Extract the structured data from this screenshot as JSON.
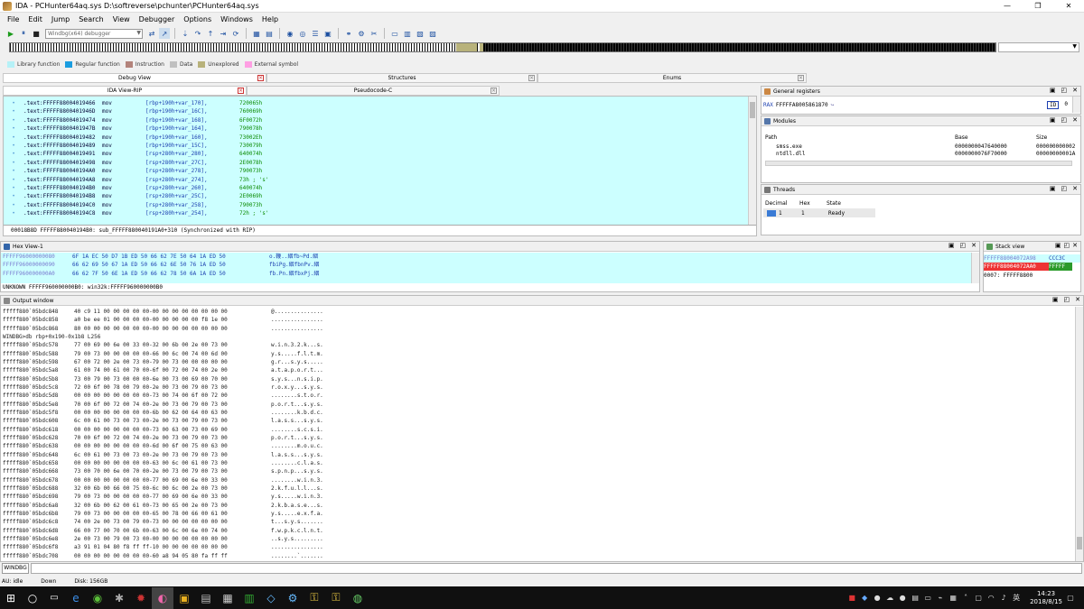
{
  "window": {
    "title": "IDA - PCHunter64aq.sys D:\\softreverse\\pchunter\\PCHunter64aq.sys",
    "controls": [
      "—",
      "❐",
      "✕"
    ]
  },
  "menu": [
    "File",
    "Edit",
    "Jump",
    "Search",
    "View",
    "Debugger",
    "Options",
    "Windows",
    "Help"
  ],
  "toolbar": {
    "debugger_select": "Windbg(x64) debugger"
  },
  "legend": [
    {
      "label": "Library function",
      "color": "#b6f1f7"
    },
    {
      "label": "Regular function",
      "color": "#1b9de0"
    },
    {
      "label": "Instruction",
      "color": "#b3837b"
    },
    {
      "label": "Data",
      "color": "#c0c0c0"
    },
    {
      "label": "Unexplored",
      "color": "#b8b27b"
    },
    {
      "label": "External symbol",
      "color": "#ff9fe3"
    }
  ],
  "tabs_top": [
    {
      "label": "Debug View",
      "active": true
    },
    {
      "label": "Structures",
      "active": false
    },
    {
      "label": "Enums",
      "active": false
    }
  ],
  "tabs_second": [
    {
      "label": "IDA View-RIP",
      "active": true
    },
    {
      "label": "Pseudocode-C",
      "active": false
    }
  ],
  "ida_view": {
    "lines": [
      {
        "addr": ".text:FFFFF88004019466",
        "mnem": "mov",
        "oper": "[rbp+190h+var_170],",
        "val": "720065h"
      },
      {
        "addr": ".text:FFFFF8800401946D",
        "mnem": "mov",
        "oper": "[rbp+190h+var_16C],",
        "val": "760069h"
      },
      {
        "addr": ".text:FFFFF88004019474",
        "mnem": "mov",
        "oper": "[rbp+190h+var_168],",
        "val": "6F0072h"
      },
      {
        "addr": ".text:FFFFF8800401947B",
        "mnem": "mov",
        "oper": "[rbp+190h+var_164],",
        "val": "790078h"
      },
      {
        "addr": ".text:FFFFF88004019482",
        "mnem": "mov",
        "oper": "[rbp+190h+var_160],",
        "val": "73002Eh"
      },
      {
        "addr": ".text:FFFFF88004019489",
        "mnem": "mov",
        "oper": "[rbp+190h+var_15C],",
        "val": "730079h"
      },
      {
        "addr": ".text:FFFFF88004019491",
        "mnem": "mov",
        "oper": "[rsp+280h+var_280],",
        "val": "640074h"
      },
      {
        "addr": ".text:FFFFF88004019498",
        "mnem": "mov",
        "oper": "[rsp+280h+var_27C],",
        "val": "2E0078h"
      },
      {
        "addr": ".text:FFFFF880040194A0",
        "mnem": "mov",
        "oper": "[rsp+280h+var_278],",
        "val": "790073h"
      },
      {
        "addr": ".text:FFFFF880040194A8",
        "mnem": "mov",
        "oper": "[rsp+280h+var_274],",
        "val": "73h ; 's'"
      },
      {
        "addr": ".text:FFFFF880040194B0",
        "mnem": "mov",
        "oper": "[rsp+280h+var_260],",
        "val": "640074h"
      },
      {
        "addr": ".text:FFFFF880040194B8",
        "mnem": "mov",
        "oper": "[rsp+280h+var_25C],",
        "val": "2E0069h"
      },
      {
        "addr": ".text:FFFFF880040194C0",
        "mnem": "mov",
        "oper": "[rsp+280h+var_258],",
        "val": "790073h"
      },
      {
        "addr": ".text:FFFFF880040194C8",
        "mnem": "mov",
        "oper": "[rsp+280h+var_254],",
        "val": "72h ; 's'"
      }
    ],
    "status": "00018B8D FFFFF880040194B0: sub_FFFFF880040191A0+310 (Synchronized with RIP)"
  },
  "hex_view": {
    "title": "Hex View-1",
    "lines": [
      {
        "addr": "FFFFF96000000080",
        "bytes": "6F 1A EC 50 D7 1B ED 50  66 62 7E 50 64 1A ED 50",
        "ascii": "o.鞭..絪fb~Pd.絪"
      },
      {
        "addr": "FFFFF96000000090",
        "bytes": "66 62 69 50 67 1A ED 50  66 62 6E 50 76 1A ED 50",
        "ascii": "fbiPg.絪fbnPv.絪"
      },
      {
        "addr": "FFFFF960000000A0",
        "bytes": "66 62 7F 50 6E 1A ED 50  66 62 78 50 6A 1A ED 50",
        "ascii": "fb.Pn.絪fbxPj.絪"
      }
    ],
    "status": "UNKNOWN FFFFF960000000B0: win32k:FFFFF960000000B0"
  },
  "registers": {
    "title": "General registers",
    "rax_label": "RAX",
    "rax_value": "FFFFFA8005861870",
    "rax_flag": "ID",
    "rax_flag_val": "0"
  },
  "modules": {
    "title": "Modules",
    "headers": [
      "Path",
      "Base",
      "Size"
    ],
    "rows": [
      {
        "path": "smss.exe",
        "base": "0000000047640000",
        "size": "000000000002"
      },
      {
        "path": "ntdll.dll",
        "base": "0000000076F70000",
        "size": "00000000001A"
      }
    ]
  },
  "threads": {
    "title": "Threads",
    "headers": [
      "Decimal",
      "Hex",
      "State"
    ],
    "rows": [
      {
        "decimal": "1",
        "hex": "1",
        "state": "Ready"
      }
    ]
  },
  "stack_view": {
    "title": "Stack view",
    "rows": [
      {
        "addr": "FFFFF88004072A98",
        "val": "CCC3C"
      },
      {
        "addr": "FFFFF88004072AA0",
        "val": "FFFFF"
      }
    ],
    "status": "0007: FFFFF8800"
  },
  "output": {
    "title": "Output window",
    "lines": [
      {
        "a": "fffff880`05bdc848",
        "b": "40 c9 11 00 00 00 00 00-00 00 00 00 00 00 00 00",
        "c": "@..............."
      },
      {
        "a": "fffff880`05bdc858",
        "b": "a0 be ee 01 00 00 00 00-00 00 00 00 00 f8 1e 00",
        "c": "................"
      },
      {
        "a": "fffff880`05bdc868",
        "b": "80 00 00 00 00 00 00 00-00 00 00 00 00 00 00 00",
        "c": "................"
      },
      {
        "a": "WINDBG>db rbp+0x190-0x1b8 L256",
        "b": "",
        "c": ""
      },
      {
        "a": "fffff880`05bdc578",
        "b": "77 00 69 00 6e 00 33 00-32 00 6b 00 2e 00 73 00",
        "c": "w.i.n.3.2.k...s."
      },
      {
        "a": "fffff880`05bdc588",
        "b": "79 00 73 00 00 00 00 00-66 00 6c 00 74 00 6d 00",
        "c": "y.s.....f.l.t.m."
      },
      {
        "a": "fffff880`05bdc598",
        "b": "67 00 72 00 2e 00 73 00-79 00 73 00 00 00 00 00",
        "c": "g.r...s.y.s....."
      },
      {
        "a": "fffff880`05bdc5a8",
        "b": "61 00 74 00 61 00 70 00-6f 00 72 00 74 00 2e 00",
        "c": "a.t.a.p.o.r.t..."
      },
      {
        "a": "fffff880`05bdc5b8",
        "b": "73 00 79 00 73 00 00 00-6e 00 73 00 69 00 70 00",
        "c": "s.y.s...n.s.i.p."
      },
      {
        "a": "fffff880`05bdc5c8",
        "b": "72 00 6f 00 78 00 79 00-2e 00 73 00 79 00 73 00",
        "c": "r.o.x.y...s.y.s."
      },
      {
        "a": "fffff880`05bdc5d8",
        "b": "00 00 00 00 00 00 00 00-73 00 74 00 6f 00 72 00",
        "c": "........s.t.o.r."
      },
      {
        "a": "fffff880`05bdc5e8",
        "b": "70 00 6f 00 72 00 74 00-2e 00 73 00 79 00 73 00",
        "c": "p.o.r.t...s.y.s."
      },
      {
        "a": "fffff880`05bdc5f8",
        "b": "00 00 00 00 00 00 00 00-6b 00 62 00 64 00 63 00",
        "c": "........k.b.d.c."
      },
      {
        "a": "fffff880`05bdc608",
        "b": "6c 00 61 00 73 00 73 00-2e 00 73 00 79 00 73 00",
        "c": "l.a.s.s...s.y.s."
      },
      {
        "a": "fffff880`05bdc618",
        "b": "00 00 00 00 00 00 00 00-73 00 63 00 73 00 69 00",
        "c": "........s.c.s.i."
      },
      {
        "a": "fffff880`05bdc628",
        "b": "70 00 6f 00 72 00 74 00-2e 00 73 00 79 00 73 00",
        "c": "p.o.r.t...s.y.s."
      },
      {
        "a": "fffff880`05bdc638",
        "b": "00 00 00 00 00 00 00 00-6d 00 6f 00 75 00 63 00",
        "c": "........m.o.u.c."
      },
      {
        "a": "fffff880`05bdc648",
        "b": "6c 00 61 00 73 00 73 00-2e 00 73 00 79 00 73 00",
        "c": "l.a.s.s...s.y.s."
      },
      {
        "a": "fffff880`05bdc658",
        "b": "00 00 00 00 00 00 00 00-63 00 6c 00 61 00 73 00",
        "c": "........c.l.a.s."
      },
      {
        "a": "fffff880`05bdc668",
        "b": "73 00 70 00 6e 00 70 00-2e 00 73 00 79 00 73 00",
        "c": "s.p.n.p...s.y.s."
      },
      {
        "a": "fffff880`05bdc678",
        "b": "00 00 00 00 00 00 00 00-77 00 69 00 6e 00 33 00",
        "c": "........w.i.n.3."
      },
      {
        "a": "fffff880`05bdc688",
        "b": "32 00 6b 00 66 00 75 00-6c 00 6c 00 2e 00 73 00",
        "c": "2.k.f.u.l.l...s."
      },
      {
        "a": "fffff880`05bdc698",
        "b": "79 00 73 00 00 00 00 00-77 00 69 00 6e 00 33 00",
        "c": "y.s.....w.i.n.3."
      },
      {
        "a": "fffff880`05bdc6a8",
        "b": "32 00 6b 00 62 00 61 00-73 00 65 00 2e 00 73 00",
        "c": "2.k.b.a.s.e...s."
      },
      {
        "a": "fffff880`05bdc6b8",
        "b": "79 00 73 00 00 00 00 00-65 00 78 00 66 00 61 00",
        "c": "y.s.....e.x.f.a."
      },
      {
        "a": "fffff880`05bdc6c8",
        "b": "74 00 2e 00 73 00 79 00-73 00 00 00 00 00 00 00",
        "c": "t...s.y.s......."
      },
      {
        "a": "fffff880`05bdc6d8",
        "b": "66 00 77 00 70 00 6b 00-63 00 6c 00 6e 00 74 00",
        "c": "f.w.p.k.c.l.n.t."
      },
      {
        "a": "fffff880`05bdc6e8",
        "b": "2e 00 73 00 79 00 73 00-00 00 00 00 00 00 00 00",
        "c": "..s.y.s........."
      },
      {
        "a": "fffff880`05bdc6f8",
        "b": "a3 91 01 04 80 f8 ff ff-10 00 00 00 00 00 00 00",
        "c": "................"
      },
      {
        "a": "fffff880`05bdc708",
        "b": "00 00 00 00 00 00 00 00-60 a8 94 05 80 fa ff ff",
        "c": "........`......."
      }
    ]
  },
  "command": {
    "label": "WINDBG"
  },
  "status": {
    "au": "AU:",
    "au_val": "idle",
    "dir": "Down",
    "disk": "Disk: 156GB"
  },
  "clock": {
    "time": "14:23",
    "date": "2018/8/15"
  },
  "tray_lang": "英"
}
